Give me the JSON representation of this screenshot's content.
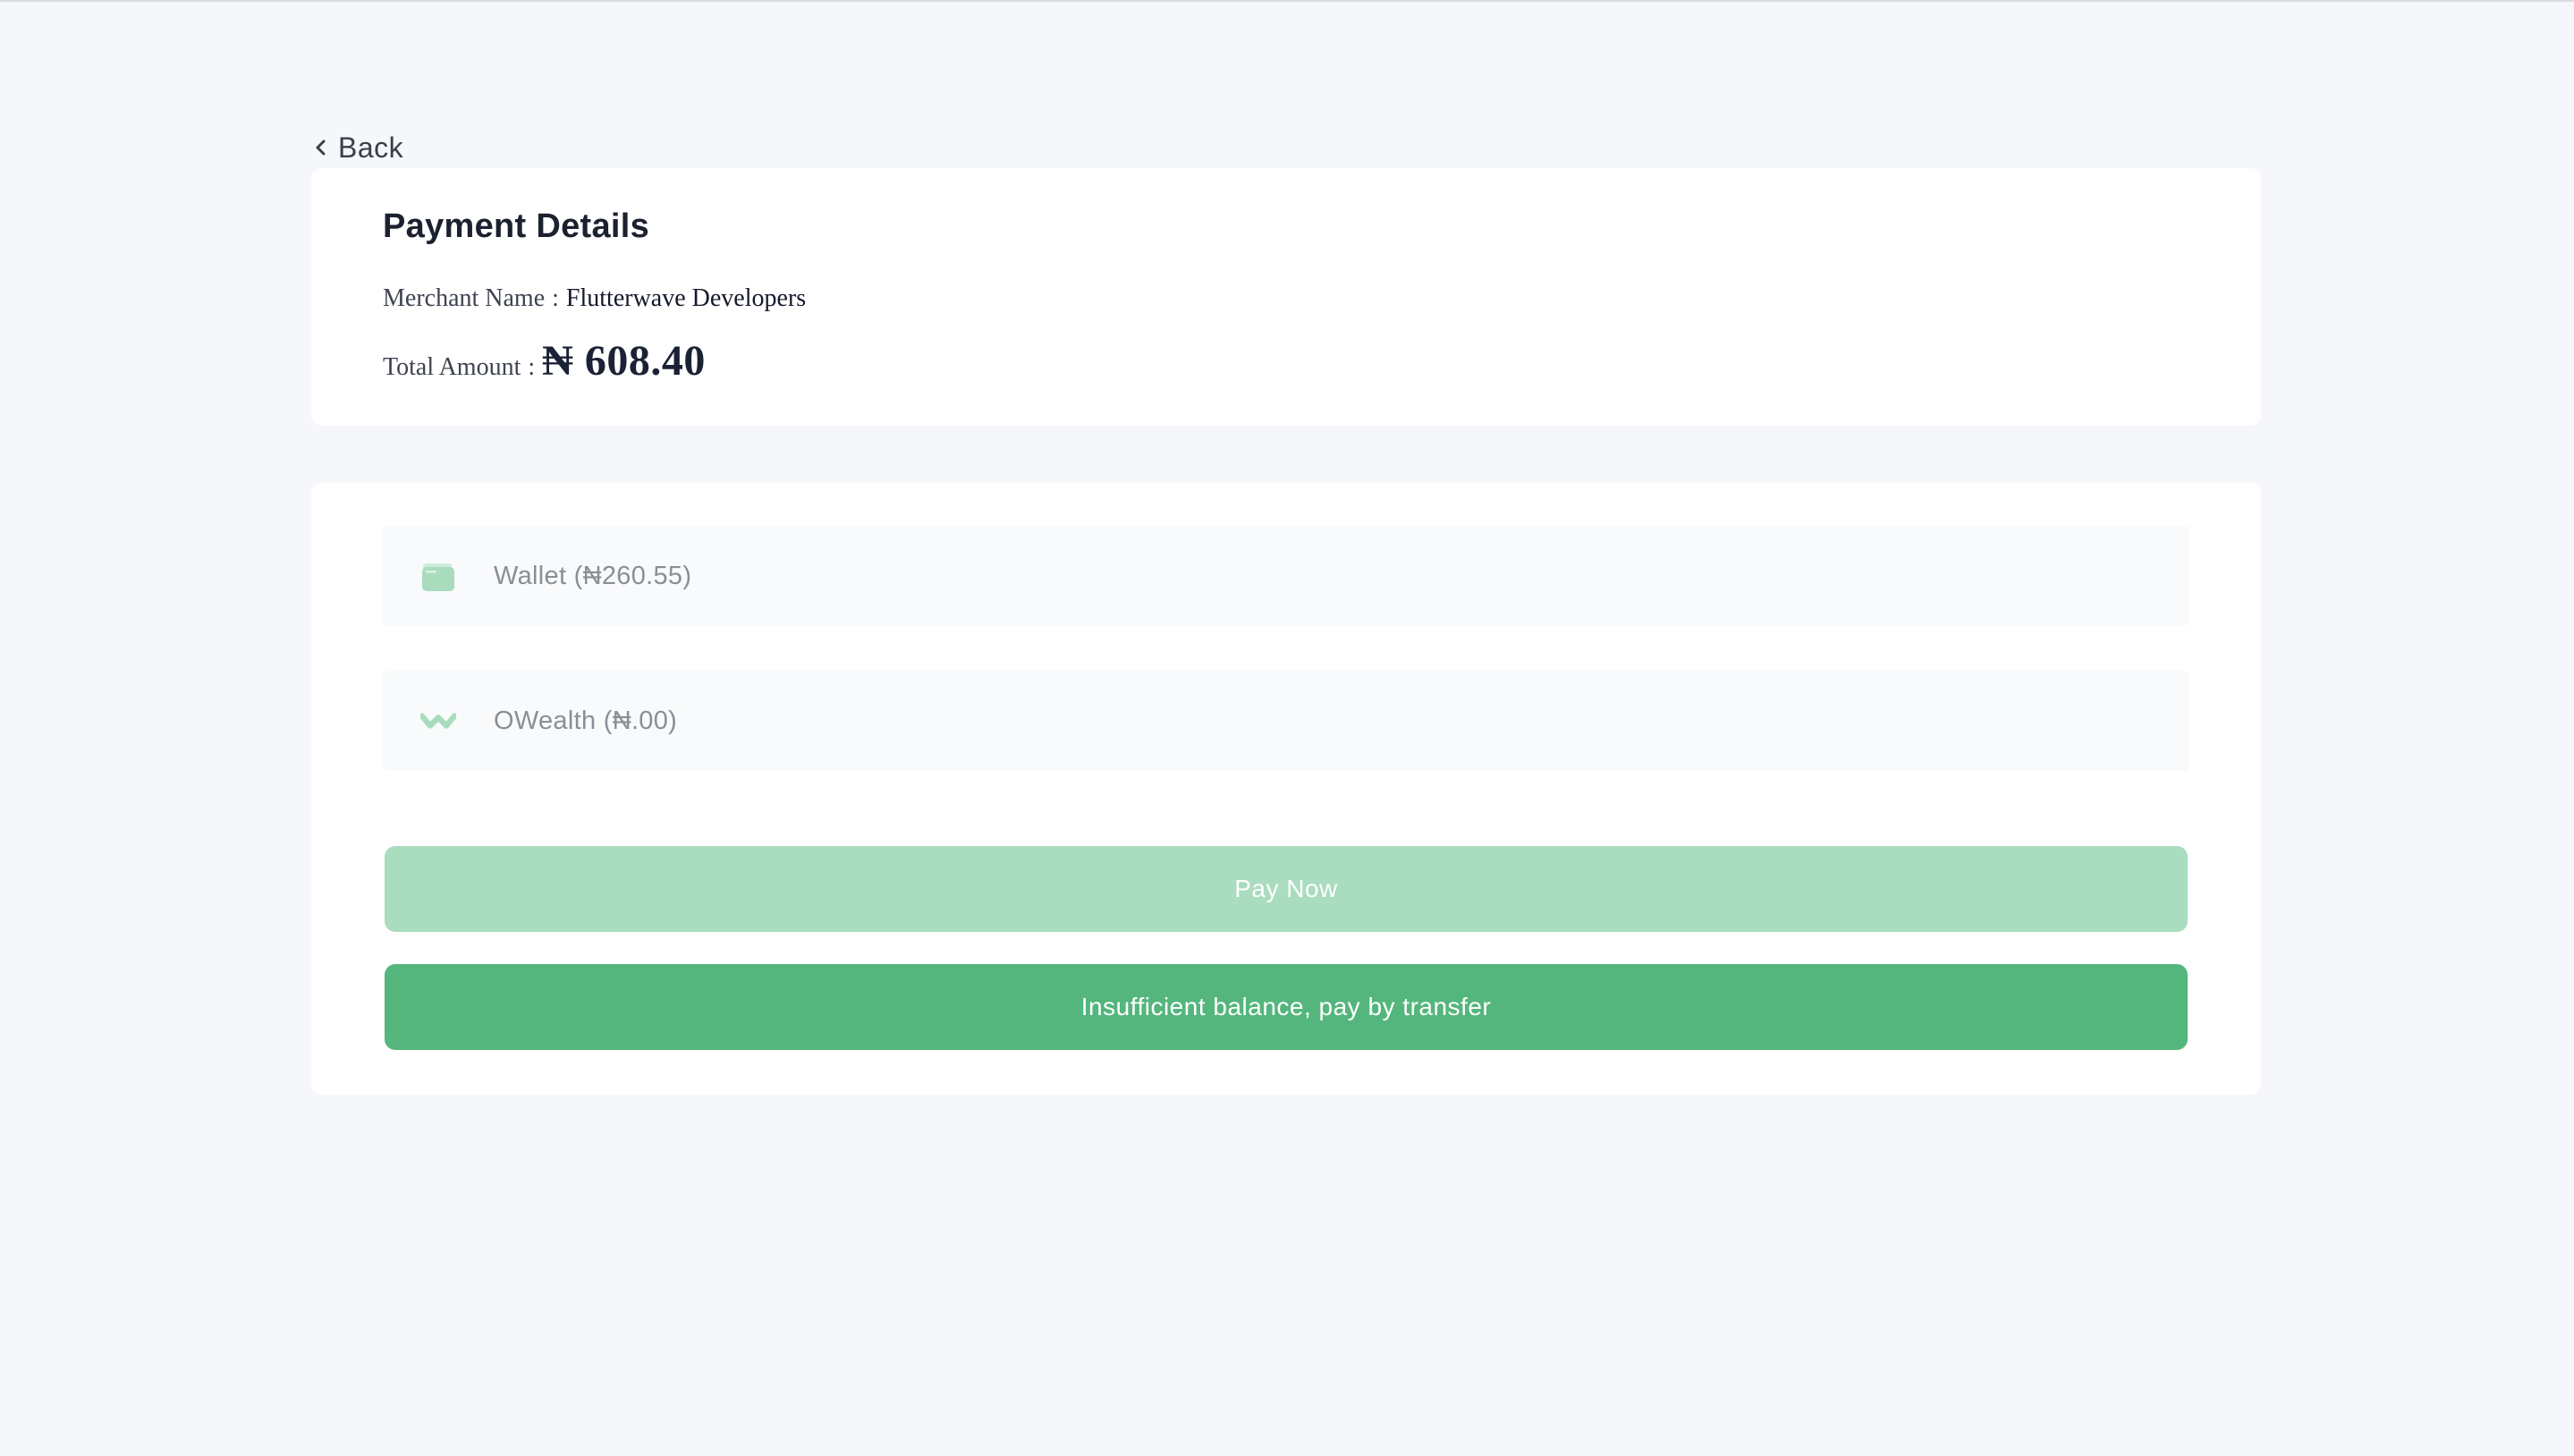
{
  "nav": {
    "back_label": "Back"
  },
  "details": {
    "title": "Payment Details",
    "merchant_key": "Merchant Name",
    "merchant_value": "Flutterwave Developers",
    "amount_key": "Total Amount",
    "amount_value": "₦ 608.40",
    "separator": ":"
  },
  "methods": [
    {
      "label": "Wallet (₦260.55)",
      "icon": "wallet-icon"
    },
    {
      "label": "OWealth (₦.00)",
      "icon": "owealth-icon"
    }
  ],
  "actions": {
    "pay_now_label": "Pay Now",
    "transfer_label": "Insufficient balance, pay by transfer"
  },
  "colors": {
    "background": "#f6f7fa",
    "card": "#ffffff",
    "accent": "#54b67c",
    "accent_disabled": "#aadcbf",
    "icon_green": "#a8dcbd"
  }
}
